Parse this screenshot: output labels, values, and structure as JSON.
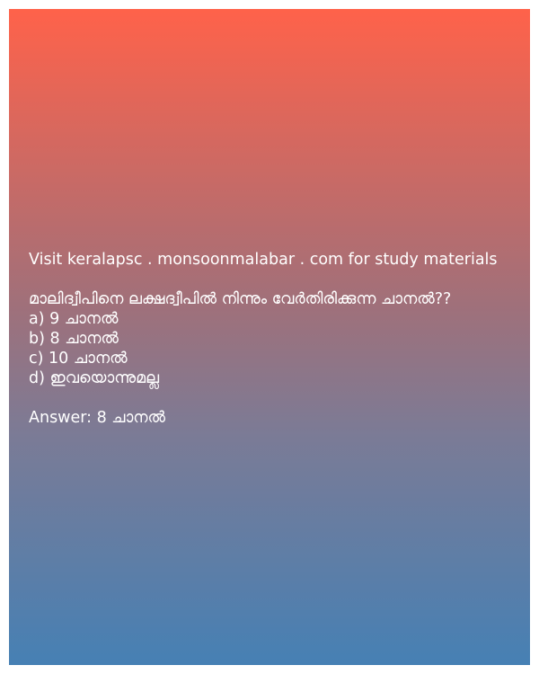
{
  "promo": "Visit keralapsc . monsoonmalabar . com for study materials",
  "question": " മാലിദ്വീപിനെ ലക്ഷദ്വീപിൽ നിന്നും വേർതിരിക്കുന്ന ചാനൽ??",
  "options": [
    "a) 9 ചാനൽ",
    "b) 8 ചാനൽ",
    "c) 10 ചാനൽ",
    "d) ഇവയൊന്നുമല്ല"
  ],
  "answer": "Answer: 8 ചാനൽ",
  "colors": {
    "gradient_top": "#ff624a",
    "gradient_bottom": "#4680b4",
    "text": "#ffffff"
  }
}
